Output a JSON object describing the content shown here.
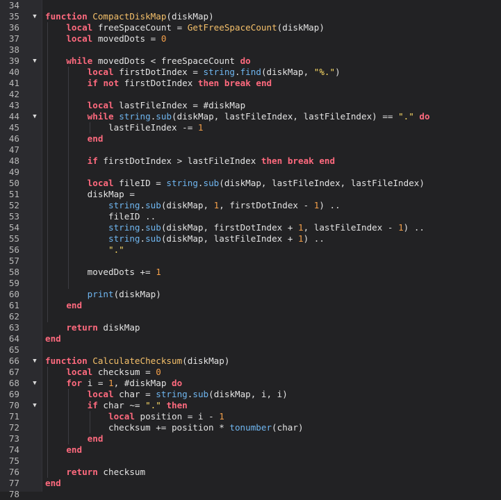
{
  "editor": {
    "language": "lua",
    "colors": {
      "background": "#222224",
      "gutter": "#2b2b2f",
      "keyword": "#ff6a7e",
      "function_name": "#f5c06a",
      "builtin": "#6fb6f0",
      "string": "#ffdd66",
      "number": "#f5a04a",
      "text": "#e3e3e3"
    },
    "lines": [
      {
        "n": "34",
        "fold": false,
        "tokens": []
      },
      {
        "n": "35",
        "fold": true,
        "tokens": [
          [
            "kw",
            "function"
          ],
          [
            "t",
            " "
          ],
          [
            "fn",
            "CompactDiskMap"
          ],
          [
            "t",
            "(diskMap)"
          ]
        ]
      },
      {
        "n": "36",
        "fold": false,
        "tokens": [
          [
            "t",
            "    "
          ],
          [
            "kw",
            "local"
          ],
          [
            "t",
            " freeSpaceCount = "
          ],
          [
            "fn",
            "GetFreeSpaceCount"
          ],
          [
            "t",
            "(diskMap)"
          ]
        ]
      },
      {
        "n": "37",
        "fold": false,
        "tokens": [
          [
            "t",
            "    "
          ],
          [
            "kw",
            "local"
          ],
          [
            "t",
            " movedDots = "
          ],
          [
            "nu",
            "0"
          ]
        ]
      },
      {
        "n": "38",
        "fold": false,
        "tokens": []
      },
      {
        "n": "39",
        "fold": true,
        "tokens": [
          [
            "t",
            "    "
          ],
          [
            "kw",
            "while"
          ],
          [
            "t",
            " movedDots < freeSpaceCount "
          ],
          [
            "kw",
            "do"
          ]
        ]
      },
      {
        "n": "40",
        "fold": false,
        "tokens": [
          [
            "t",
            "        "
          ],
          [
            "kw",
            "local"
          ],
          [
            "t",
            " firstDotIndex = "
          ],
          [
            "bi",
            "string"
          ],
          [
            "t",
            "."
          ],
          [
            "bi",
            "find"
          ],
          [
            "t",
            "(diskMap, "
          ],
          [
            "st",
            "\"%.\""
          ],
          [
            "t",
            ")"
          ]
        ]
      },
      {
        "n": "41",
        "fold": false,
        "tokens": [
          [
            "t",
            "        "
          ],
          [
            "kw",
            "if"
          ],
          [
            "t",
            " "
          ],
          [
            "kw",
            "not"
          ],
          [
            "t",
            " firstDotIndex "
          ],
          [
            "kw",
            "then"
          ],
          [
            "t",
            " "
          ],
          [
            "kw",
            "break"
          ],
          [
            "t",
            " "
          ],
          [
            "kw",
            "end"
          ]
        ]
      },
      {
        "n": "42",
        "fold": false,
        "tokens": []
      },
      {
        "n": "43",
        "fold": false,
        "tokens": [
          [
            "t",
            "        "
          ],
          [
            "kw",
            "local"
          ],
          [
            "t",
            " lastFileIndex = #diskMap"
          ]
        ]
      },
      {
        "n": "44",
        "fold": true,
        "tokens": [
          [
            "t",
            "        "
          ],
          [
            "kw",
            "while"
          ],
          [
            "t",
            " "
          ],
          [
            "bi",
            "string"
          ],
          [
            "t",
            "."
          ],
          [
            "bi",
            "sub"
          ],
          [
            "t",
            "(diskMap, lastFileIndex, lastFileIndex) == "
          ],
          [
            "st",
            "\".\""
          ],
          [
            "t",
            " "
          ],
          [
            "kw",
            "do"
          ]
        ]
      },
      {
        "n": "45",
        "fold": false,
        "tokens": [
          [
            "t",
            "            lastFileIndex -= "
          ],
          [
            "nu",
            "1"
          ]
        ]
      },
      {
        "n": "46",
        "fold": false,
        "tokens": [
          [
            "t",
            "        "
          ],
          [
            "kw",
            "end"
          ]
        ]
      },
      {
        "n": "47",
        "fold": false,
        "tokens": []
      },
      {
        "n": "48",
        "fold": false,
        "tokens": [
          [
            "t",
            "        "
          ],
          [
            "kw",
            "if"
          ],
          [
            "t",
            " firstDotIndex > lastFileIndex "
          ],
          [
            "kw",
            "then"
          ],
          [
            "t",
            " "
          ],
          [
            "kw",
            "break"
          ],
          [
            "t",
            " "
          ],
          [
            "kw",
            "end"
          ]
        ]
      },
      {
        "n": "49",
        "fold": false,
        "tokens": []
      },
      {
        "n": "50",
        "fold": false,
        "tokens": [
          [
            "t",
            "        "
          ],
          [
            "kw",
            "local"
          ],
          [
            "t",
            " fileID = "
          ],
          [
            "bi",
            "string"
          ],
          [
            "t",
            "."
          ],
          [
            "bi",
            "sub"
          ],
          [
            "t",
            "(diskMap, lastFileIndex, lastFileIndex)"
          ]
        ]
      },
      {
        "n": "51",
        "fold": false,
        "tokens": [
          [
            "t",
            "        diskMap ="
          ]
        ]
      },
      {
        "n": "52",
        "fold": false,
        "tokens": [
          [
            "t",
            "            "
          ],
          [
            "bi",
            "string"
          ],
          [
            "t",
            "."
          ],
          [
            "bi",
            "sub"
          ],
          [
            "t",
            "(diskMap, "
          ],
          [
            "nu",
            "1"
          ],
          [
            "t",
            ", firstDotIndex - "
          ],
          [
            "nu",
            "1"
          ],
          [
            "t",
            ") .."
          ]
        ]
      },
      {
        "n": "53",
        "fold": false,
        "tokens": [
          [
            "t",
            "            fileID .."
          ]
        ]
      },
      {
        "n": "54",
        "fold": false,
        "tokens": [
          [
            "t",
            "            "
          ],
          [
            "bi",
            "string"
          ],
          [
            "t",
            "."
          ],
          [
            "bi",
            "sub"
          ],
          [
            "t",
            "(diskMap, firstDotIndex + "
          ],
          [
            "nu",
            "1"
          ],
          [
            "t",
            ", lastFileIndex - "
          ],
          [
            "nu",
            "1"
          ],
          [
            "t",
            ") .."
          ]
        ]
      },
      {
        "n": "55",
        "fold": false,
        "tokens": [
          [
            "t",
            "            "
          ],
          [
            "bi",
            "string"
          ],
          [
            "t",
            "."
          ],
          [
            "bi",
            "sub"
          ],
          [
            "t",
            "(diskMap, lastFileIndex + "
          ],
          [
            "nu",
            "1"
          ],
          [
            "t",
            ") .."
          ]
        ]
      },
      {
        "n": "56",
        "fold": false,
        "tokens": [
          [
            "t",
            "            "
          ],
          [
            "st",
            "\".\""
          ]
        ]
      },
      {
        "n": "57",
        "fold": false,
        "tokens": []
      },
      {
        "n": "58",
        "fold": false,
        "tokens": [
          [
            "t",
            "        movedDots += "
          ],
          [
            "nu",
            "1"
          ]
        ]
      },
      {
        "n": "59",
        "fold": false,
        "tokens": []
      },
      {
        "n": "60",
        "fold": false,
        "tokens": [
          [
            "t",
            "        "
          ],
          [
            "bi",
            "print"
          ],
          [
            "t",
            "(diskMap)"
          ]
        ]
      },
      {
        "n": "61",
        "fold": false,
        "tokens": [
          [
            "t",
            "    "
          ],
          [
            "kw",
            "end"
          ]
        ]
      },
      {
        "n": "62",
        "fold": false,
        "tokens": []
      },
      {
        "n": "63",
        "fold": false,
        "tokens": [
          [
            "t",
            "    "
          ],
          [
            "kw",
            "return"
          ],
          [
            "t",
            " diskMap"
          ]
        ]
      },
      {
        "n": "64",
        "fold": false,
        "tokens": [
          [
            "kw",
            "end"
          ]
        ]
      },
      {
        "n": "65",
        "fold": false,
        "tokens": []
      },
      {
        "n": "66",
        "fold": true,
        "tokens": [
          [
            "kw",
            "function"
          ],
          [
            "t",
            " "
          ],
          [
            "fn",
            "CalculateChecksum"
          ],
          [
            "t",
            "(diskMap)"
          ]
        ]
      },
      {
        "n": "67",
        "fold": false,
        "tokens": [
          [
            "t",
            "    "
          ],
          [
            "kw",
            "local"
          ],
          [
            "t",
            " checksum = "
          ],
          [
            "nu",
            "0"
          ]
        ]
      },
      {
        "n": "68",
        "fold": true,
        "tokens": [
          [
            "t",
            "    "
          ],
          [
            "kw",
            "for"
          ],
          [
            "t",
            " i = "
          ],
          [
            "nu",
            "1"
          ],
          [
            "t",
            ", #diskMap "
          ],
          [
            "kw",
            "do"
          ]
        ]
      },
      {
        "n": "69",
        "fold": false,
        "tokens": [
          [
            "t",
            "        "
          ],
          [
            "kw",
            "local"
          ],
          [
            "t",
            " char = "
          ],
          [
            "bi",
            "string"
          ],
          [
            "t",
            "."
          ],
          [
            "bi",
            "sub"
          ],
          [
            "t",
            "(diskMap, i, i)"
          ]
        ]
      },
      {
        "n": "70",
        "fold": true,
        "tokens": [
          [
            "t",
            "        "
          ],
          [
            "kw",
            "if"
          ],
          [
            "t",
            " char ~= "
          ],
          [
            "st",
            "\".\""
          ],
          [
            "t",
            " "
          ],
          [
            "kw",
            "then"
          ]
        ]
      },
      {
        "n": "71",
        "fold": false,
        "tokens": [
          [
            "t",
            "            "
          ],
          [
            "kw",
            "local"
          ],
          [
            "t",
            " position = i - "
          ],
          [
            "nu",
            "1"
          ]
        ]
      },
      {
        "n": "72",
        "fold": false,
        "tokens": [
          [
            "t",
            "            checksum += position * "
          ],
          [
            "bi",
            "tonumber"
          ],
          [
            "t",
            "(char)"
          ]
        ]
      },
      {
        "n": "73",
        "fold": false,
        "tokens": [
          [
            "t",
            "        "
          ],
          [
            "kw",
            "end"
          ]
        ]
      },
      {
        "n": "74",
        "fold": false,
        "tokens": [
          [
            "t",
            "    "
          ],
          [
            "kw",
            "end"
          ]
        ]
      },
      {
        "n": "75",
        "fold": false,
        "tokens": []
      },
      {
        "n": "76",
        "fold": false,
        "tokens": [
          [
            "t",
            "    "
          ],
          [
            "kw",
            "return"
          ],
          [
            "t",
            " checksum"
          ]
        ]
      },
      {
        "n": "77",
        "fold": false,
        "tokens": [
          [
            "kw",
            "end"
          ]
        ]
      },
      {
        "n": "78",
        "fold": false,
        "tokens": []
      }
    ]
  }
}
